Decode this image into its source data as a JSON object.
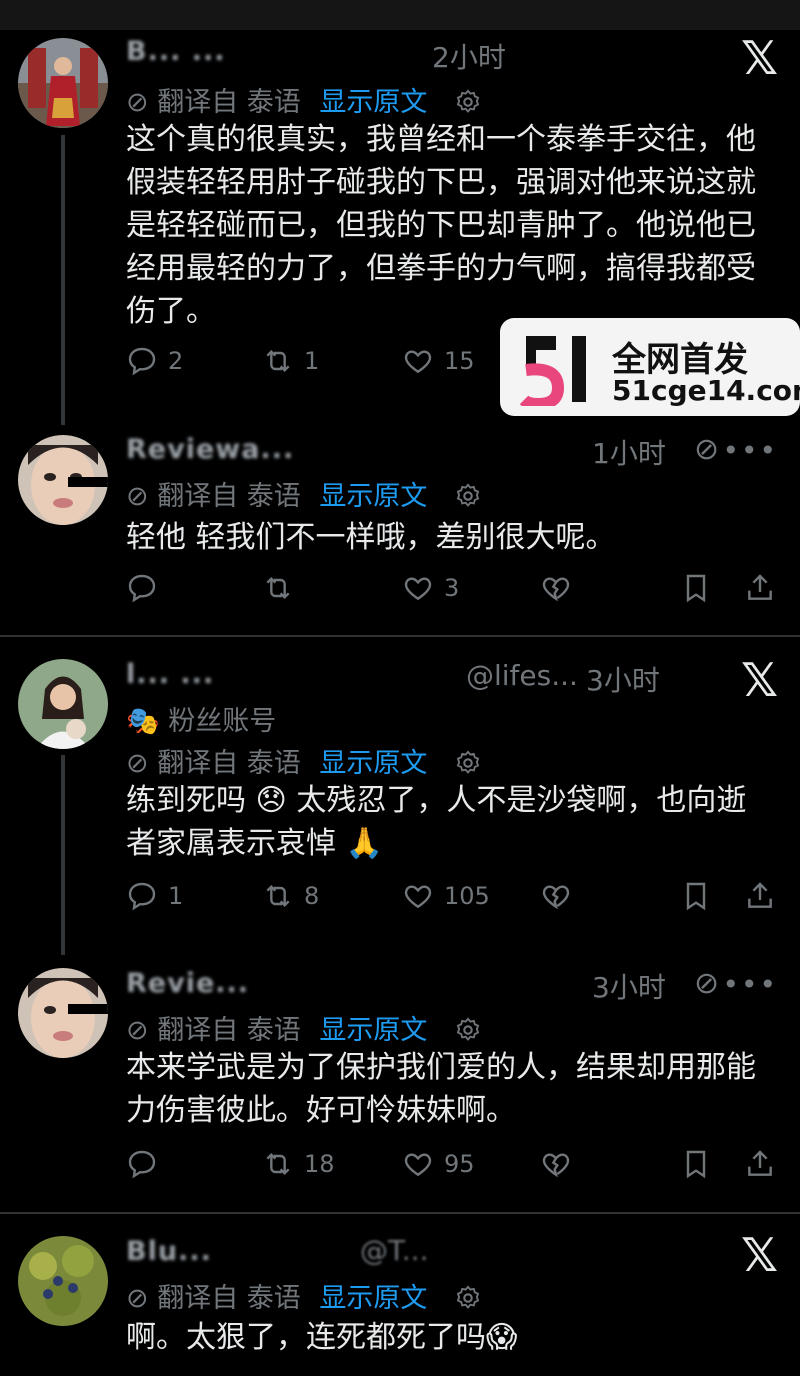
{
  "labels": {
    "translate_from": "翻译自 泰语",
    "show_original": "显示原文",
    "fan_account": "粉丝账号"
  },
  "watermark": {
    "title": "全网首发",
    "site": "51cge14.com"
  },
  "colors": {
    "background": "#000000",
    "text": "#e7e9ea",
    "muted": "#71767b",
    "link": "#1d9bf0",
    "separator": "#2f3336"
  },
  "posts": [
    {
      "time": "2小时",
      "name": "B... ...",
      "text": "这个真的很真实，我曾经和一个泰拳手交往，他假装轻轻用肘子碰我的下巴，强调对他来说这就是轻轻碰而已，但我的下巴却青肿了。他说他已经用最轻的力了，但拳手的力气啊，搞得我都受伤了。",
      "replies": "2",
      "reposts": "1",
      "likes": "15"
    },
    {
      "time": "1小时",
      "name": "Reviewa...",
      "text": "轻他 轻我们不一样哦，差别很大呢。",
      "replies": "",
      "reposts": "",
      "likes": "3"
    },
    {
      "time": "3小时",
      "name": "l... ...",
      "handle": "@lifes...",
      "text": "练到死吗 😞 太残忍了，人不是沙袋啊，也向逝者家属表示哀悼 🙏",
      "replies": "1",
      "reposts": "8",
      "likes": "105"
    },
    {
      "time": "3小时",
      "name": "Revie...",
      "text": "本来学武是为了保护我们爱的人，结果却用那能力伤害彼此。好可怜妹妹啊。",
      "replies": "",
      "reposts": "18",
      "likes": "95"
    },
    {
      "time": "",
      "name": "Blu...",
      "handle": "@T...",
      "text": "啊。太狠了，连死都死了吗😱",
      "replies": "",
      "reposts": "",
      "likes": ""
    }
  ]
}
